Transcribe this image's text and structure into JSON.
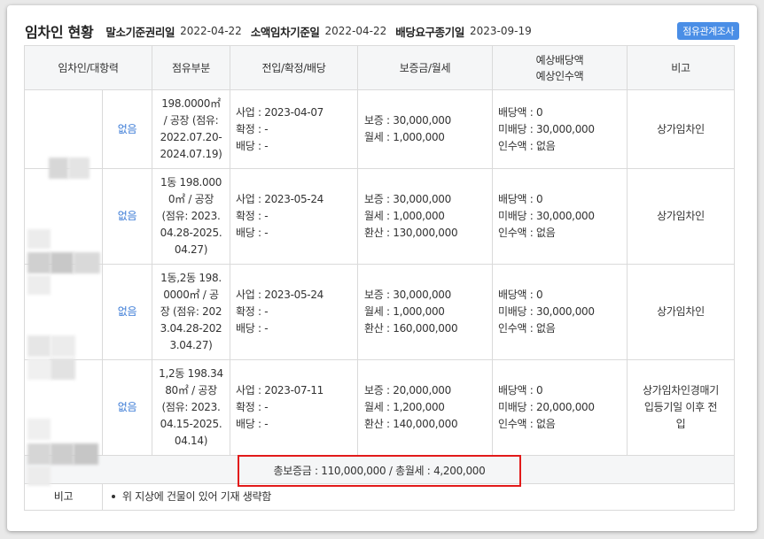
{
  "header": {
    "title": "임차인 현황",
    "meta": [
      {
        "label": "말소기준권리일",
        "value": "2022-04-22"
      },
      {
        "label": "소액임차기준일",
        "value": "2022-04-22"
      },
      {
        "label": "배당요구종기일",
        "value": "2023-09-19"
      }
    ],
    "survey_button": "점유관계조사"
  },
  "columns": {
    "tenant": "임차인/대항력",
    "occupancy": "점유부분",
    "dates": "전입/확정/배당",
    "deposit": "보증금/월세",
    "expected_line1": "예상배당액",
    "expected_line2": "예상인수액",
    "note": "비고"
  },
  "rows": [
    {
      "opposing": "없음",
      "occupancy": [
        "198.0000㎡",
        "/ 공장 (점유:",
        "2022.07.20-",
        "2024.07.19)"
      ],
      "dates": [
        "사업 : 2023-04-07",
        "확정 : -",
        "배당 : -"
      ],
      "deposit": [
        "보증 : 30,000,000",
        "월세 : 1,000,000"
      ],
      "expected": [
        "배당액 : 0",
        "미배당 : 30,000,000",
        "인수액 : 없음"
      ],
      "note": [
        "상가임차인"
      ]
    },
    {
      "opposing": "없음",
      "occupancy": [
        "1동 198.000",
        "0㎡ / 공장",
        "(점유: 2023.",
        "04.28-2025.",
        "04.27)"
      ],
      "dates": [
        "사업 : 2023-05-24",
        "확정 : -",
        "배당 : -"
      ],
      "deposit": [
        "보증 : 30,000,000",
        "월세 : 1,000,000",
        "환산 : 130,000,000"
      ],
      "expected": [
        "배당액 : 0",
        "미배당 : 30,000,000",
        "인수액 : 없음"
      ],
      "note": [
        "상가임차인"
      ]
    },
    {
      "opposing": "없음",
      "occupancy": [
        "1동,2동 198.",
        "0000㎡ / 공",
        "장 (점유: 202",
        "3.04.28-202",
        "3.04.27)"
      ],
      "dates": [
        "사업 : 2023-05-24",
        "확정 : -",
        "배당 : -"
      ],
      "deposit": [
        "보증 : 30,000,000",
        "월세 : 1,000,000",
        "환산 : 160,000,000"
      ],
      "expected": [
        "배당액 : 0",
        "미배당 : 30,000,000",
        "인수액 : 없음"
      ],
      "note": [
        "상가임차인"
      ]
    },
    {
      "opposing": "없음",
      "occupancy": [
        "1,2동 198.34",
        "80㎡ / 공장",
        "(점유: 2023.",
        "04.15-2025.",
        "04.14)"
      ],
      "dates": [
        "사업 : 2023-07-11",
        "확정 : -",
        "배당 : -"
      ],
      "deposit": [
        "보증 : 20,000,000",
        "월세 : 1,200,000",
        "환산 : 140,000,000"
      ],
      "expected": [
        "배당액 : 0",
        "미배당 : 20,000,000",
        "인수액 : 없음"
      ],
      "note": [
        "상가임차인경매기",
        "입등기일 이후 전",
        "입"
      ]
    }
  ],
  "total": "총보증금 : 110,000,000  /  총월세 : 4,200,000",
  "remarks": {
    "label": "비고",
    "items": [
      "위 지상에 건물이 있어 기재 생략함"
    ]
  },
  "colors": {
    "accent": "#4a8ee6",
    "link": "#3b7bd6",
    "highlight_border": "#e21a1a",
    "header_bg": "#f5f6f7"
  }
}
